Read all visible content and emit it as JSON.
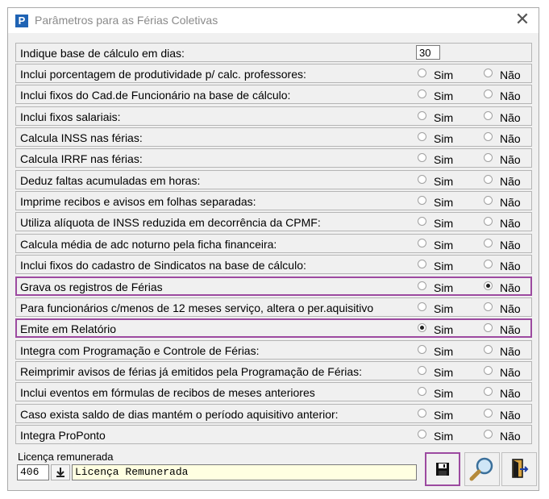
{
  "window": {
    "title": "Parâmetros para as Férias Coletivas",
    "app_icon_letter": "P",
    "close_glyph": "✕"
  },
  "base_dias": {
    "label": "Indique base de cálculo em dias:",
    "value": "30"
  },
  "options": {
    "sim_label": "Sim",
    "nao_label": "Não"
  },
  "rows": [
    {
      "label": "Inclui porcentagem de produtividade p/ calc. professores:",
      "selected": "none",
      "highlighted": false
    },
    {
      "label": "Inclui fixos do Cad.de Funcionário na base de cálculo:",
      "selected": "none",
      "highlighted": false
    },
    {
      "label": "Inclui fixos salariais:",
      "selected": "none",
      "highlighted": false
    },
    {
      "label": "Calcula INSS nas férias:",
      "selected": "none",
      "highlighted": false
    },
    {
      "label": "Calcula IRRF nas férias:",
      "selected": "none",
      "highlighted": false
    },
    {
      "label": "Deduz faltas acumuladas em horas:",
      "selected": "none",
      "highlighted": false
    },
    {
      "label": "Imprime recibos e avisos em folhas separadas:",
      "selected": "none",
      "highlighted": false
    },
    {
      "label": "Utiliza alíquota de INSS reduzida em decorrência da CPMF:",
      "selected": "none",
      "highlighted": false
    },
    {
      "label": "Calcula média de adc noturno pela ficha financeira:",
      "selected": "none",
      "highlighted": false
    },
    {
      "label": "Inclui fixos do cadastro de Sindicatos na base de cálculo:",
      "selected": "none",
      "highlighted": false
    },
    {
      "label": "Grava os registros de Férias",
      "selected": "nao",
      "highlighted": true
    },
    {
      "label": "Para funcionários c/menos de 12 meses serviço, altera o per.aquisitivo",
      "selected": "none",
      "highlighted": false
    },
    {
      "label": "Emite em Relatório",
      "selected": "sim",
      "highlighted": true
    },
    {
      "label": "Integra com Programação e Controle de Férias:",
      "selected": "none",
      "highlighted": false
    },
    {
      "label": "Reimprimir avisos de férias já emitidos pela Programação de Férias:",
      "selected": "none",
      "highlighted": false
    },
    {
      "label": "Inclui eventos em fórmulas de recibos de meses anteriores",
      "selected": "none",
      "highlighted": false
    },
    {
      "label": "Caso exista saldo de dias mantém o período aquisitivo anterior:",
      "selected": "none",
      "highlighted": false
    },
    {
      "label": "Integra ProPonto",
      "selected": "none",
      "highlighted": false
    }
  ],
  "licenca": {
    "label": "Licença remunerada",
    "code": "406",
    "name": "Licença Remunerada"
  },
  "buttons": {
    "save_icon": "floppy-disk-icon",
    "search_icon": "magnifier-icon",
    "exit_icon": "exit-door-icon"
  },
  "colors": {
    "highlight": "#9c4aa0",
    "title_icon": "#1f63b4",
    "lookup_bg": "#ffffe1"
  }
}
